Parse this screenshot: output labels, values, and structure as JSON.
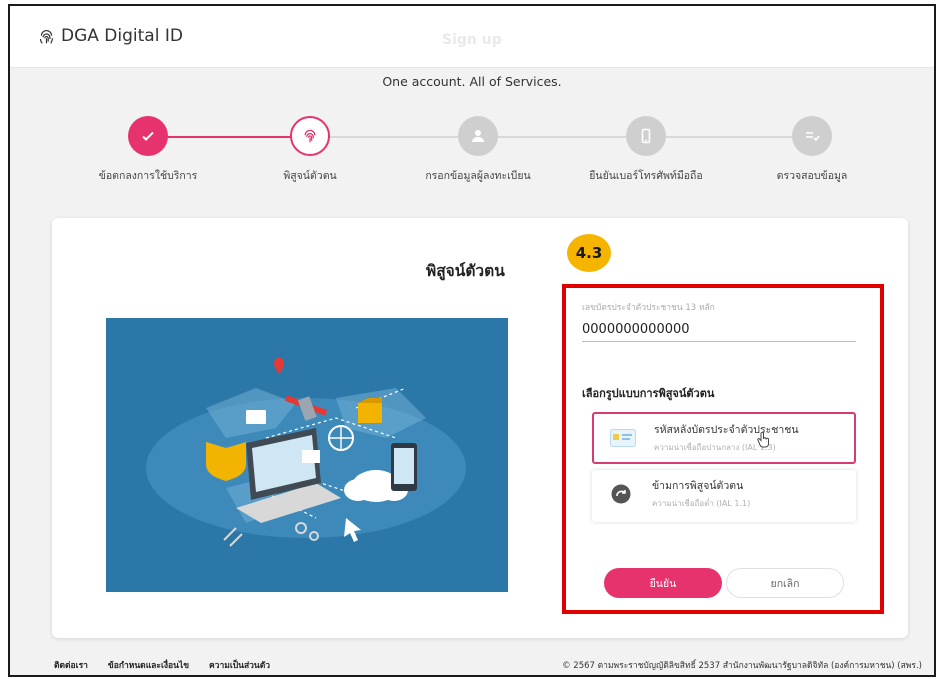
{
  "header": {
    "brand": "DGA Digital ID",
    "ghost_title": "Sign up"
  },
  "tagline": "One account. All of Services.",
  "steps": [
    {
      "label": "ข้อตกลงการใช้บริการ",
      "state": "done",
      "icon": "check-icon"
    },
    {
      "label": "พิสูจน์ตัวตน",
      "state": "current",
      "icon": "fingerprint-icon"
    },
    {
      "label": "กรอกข้อมูลผู้ลงทะเบียน",
      "state": "todo",
      "icon": "user-icon"
    },
    {
      "label": "ยืนยันเบอร์โทรศัพท์มือถือ",
      "state": "todo",
      "icon": "phone-icon"
    },
    {
      "label": "ตรวจสอบข้อมูล",
      "state": "todo",
      "icon": "list-check-icon"
    }
  ],
  "card": {
    "title": "พิสูจน์ตัวตน",
    "badge": "4.3",
    "id_field": {
      "label": "เลขบัตรประจำตัวประชาชน 13 หลัก",
      "value": "0000000000000"
    },
    "method_title": "เลือกรูปแบบการพิสูจน์ตัวตน",
    "options": [
      {
        "label": "รหัสหลังบัตรประจำตัวประชาชน",
        "sub": "ความน่าเชื่อถือปานกลาง (IAL 1.3)",
        "icon": "id-card-icon",
        "selected": true
      },
      {
        "label": "ข้ามการพิสูจน์ตัวตน",
        "sub": "ความน่าเชื่อถือต่ำ (IAL 1.1)",
        "icon": "skip-icon",
        "selected": false
      }
    ],
    "confirm_label": "ยืนยัน",
    "cancel_label": "ยกเลิก"
  },
  "footer": {
    "links": [
      "ติดต่อเรา",
      "ข้อกำหนดและเงื่อนไข",
      "ความเป็นส่วนตัว"
    ],
    "copyright": "© 2567 ตามพระราชบัญญัติลิขสิทธิ์ 2537 สำนักงานพัฒนารัฐบาลดิจิทัล (องค์การมหาชน) (สพร.)"
  },
  "colors": {
    "accent": "#e6336e",
    "highlight": "#e00000",
    "badge": "#f5b400",
    "illustration_bg": "#2b77a7"
  }
}
